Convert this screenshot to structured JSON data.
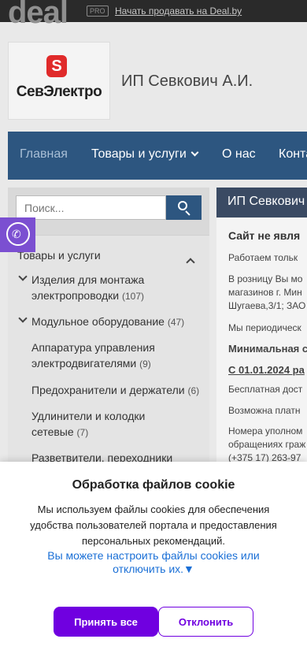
{
  "header": {
    "logo_text": "deal",
    "pro_badge": "PRO",
    "sell_link": "Начать продавать на Deal.by"
  },
  "company": {
    "logo_mark": "S",
    "logo_brand": "СевЭлектро",
    "name": "ИП Севкович А.И."
  },
  "nav": {
    "items": [
      "Главная",
      "Товары и услуги",
      "О нас",
      "Конта"
    ]
  },
  "search": {
    "placeholder": "Поиск..."
  },
  "categories": {
    "title": "Товары и услуги",
    "items": [
      {
        "line1": "Изделия для монтажа",
        "line2": "электропроводки",
        "count": "(107)"
      },
      {
        "line1": "Модульное оборудование",
        "count": "(47)"
      },
      {
        "line1": "Аппаратура управления",
        "line2": "электродвигателями",
        "count": "(9)"
      },
      {
        "line1": "Предохранители и держатели",
        "count": "(6)"
      },
      {
        "line1": "Удлинители и колодки",
        "line2": "сетевые",
        "count": "(7)"
      },
      {
        "line1": "Разветвители, переходники"
      }
    ]
  },
  "content": {
    "header": "ИП Севкович",
    "lines": [
      "Сайт не явля",
      "Работаем тольк",
      "В розницу Вы мо",
      "магазинов г. Мин",
      "Шугаева,3/1; ЗАО",
      "Мы периодическ",
      "Минимальная с",
      "С 01.01.2024  ра",
      "Бесплатная дост",
      "Возможна платн",
      "Номера уполном",
      "обращениях граж",
      "(+375 17) 263-97"
    ]
  },
  "cookie": {
    "title": "Обработка файлов cookie",
    "text": "Мы используем файлы cookies для обеспечения удобства пользователей портала и предоставления персональных рекомендаций.",
    "link": "Вы можете настроить файлы cookies или отключить их.▼",
    "accept": "Принять все",
    "decline": "Отклонить"
  },
  "colors": {
    "nav_bg": "#2d5680",
    "accent_purple": "#7000e0",
    "viber": "#7b4fd1",
    "link_blue": "#1a6fd6"
  }
}
